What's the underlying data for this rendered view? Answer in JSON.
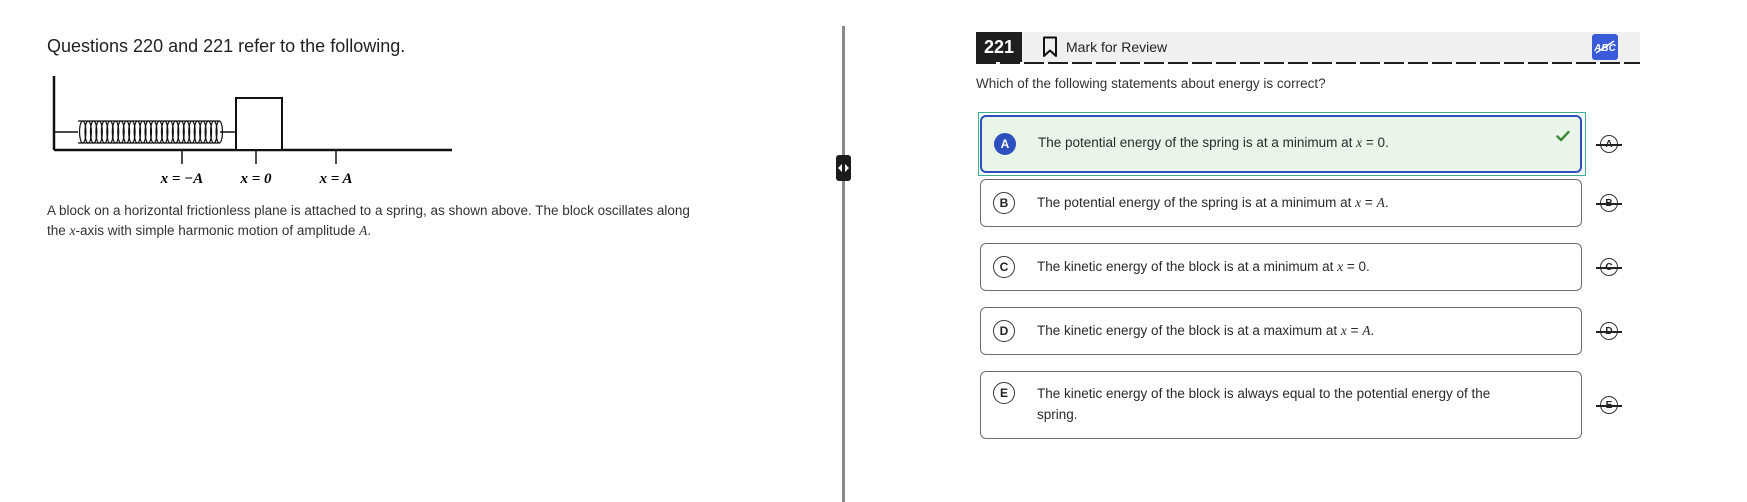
{
  "passage": {
    "title": "Questions 220 and 221 refer to the following.",
    "figure_labels": {
      "left": "x = −A",
      "center": "x = 0",
      "right": "x = A"
    },
    "text_part1": "A block on a horizontal frictionless plane is attached to a spring, as shown above. The block oscillates along the ",
    "text_var_x": "x",
    "text_part2": "-axis with simple harmonic motion of amplitude ",
    "text_var_A": "A",
    "text_part3": "."
  },
  "question": {
    "number": "221",
    "mark_for_review": "Mark for Review",
    "abc_label": "ABC",
    "stem": "Which of the following statements about energy is correct?",
    "selected": "A",
    "choices": [
      {
        "letter": "A",
        "pre": "The potential energy of the spring is at a minimum at ",
        "var": "x",
        "post": " = 0."
      },
      {
        "letter": "B",
        "pre": "The potential energy of the spring is at a minimum at ",
        "var": "x",
        "post": " = ",
        "var2": "A",
        "post2": "."
      },
      {
        "letter": "C",
        "pre": "The kinetic energy of the block is at a minimum at ",
        "var": "x",
        "post": " = 0."
      },
      {
        "letter": "D",
        "pre": "The kinetic energy of the block is at a maximum at ",
        "var": "x",
        "post": " = ",
        "var2": "A",
        "post2": "."
      },
      {
        "letter": "E",
        "pre": "The kinetic energy of the block is always equal to the potential energy of the spring."
      }
    ]
  },
  "colors": {
    "accent": "#2d4fbf",
    "selected_bg": "#eaf5e9",
    "check": "#3a8a3a",
    "header_bg": "#f0f0f0"
  },
  "icons": [
    "bookmark-icon",
    "abc-strikethrough-icon",
    "checkmark-icon",
    "resize-handle-icon",
    "strikethrough-choice-icon"
  ]
}
